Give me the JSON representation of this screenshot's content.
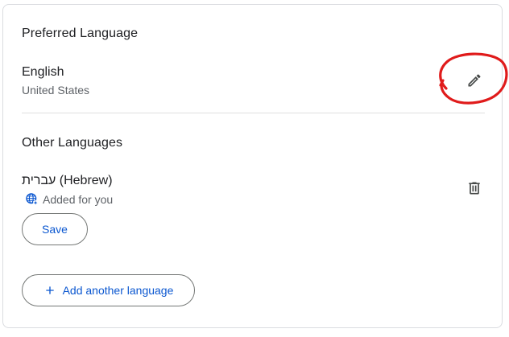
{
  "preferred": {
    "title": "Preferred Language",
    "language": "English",
    "region": "United States"
  },
  "other": {
    "title": "Other Languages",
    "items": [
      {
        "language": "עברית (Hebrew)",
        "note": "Added for you",
        "save_label": "Save"
      }
    ]
  },
  "add_label": "Add another language",
  "icons": {
    "edit": "pencil-icon",
    "delete": "trash-icon",
    "globe": "globe-icon",
    "add": "plus-icon",
    "annotation": "red-circle-annotation"
  },
  "colors": {
    "accent": "#0b57d0",
    "annotation": "#e01b1b"
  }
}
